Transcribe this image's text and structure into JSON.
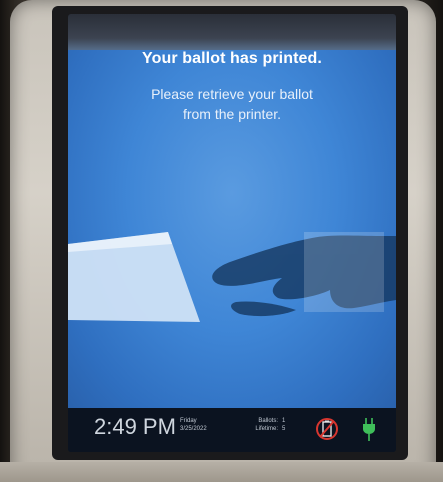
{
  "screen": {
    "heading": "Your ballot has printed.",
    "message_line1": "Please retrieve your ballot",
    "message_line2": "from the printer."
  },
  "status_bar": {
    "time": "2:49 PM",
    "day": "Friday",
    "date": "3/25/2022",
    "ballots_label": "Ballots:",
    "ballots_value": "1",
    "lifetime_label": "Lifetime:",
    "lifetime_value": "5",
    "icons": [
      "battery-warning-icon",
      "power-plug-icon"
    ]
  },
  "colors": {
    "screen_blue": "#3f86d6",
    "status_bar_bg": "#0b1320",
    "battery_warning_red": "#d8362f",
    "plug_green": "#3fbf5a"
  }
}
